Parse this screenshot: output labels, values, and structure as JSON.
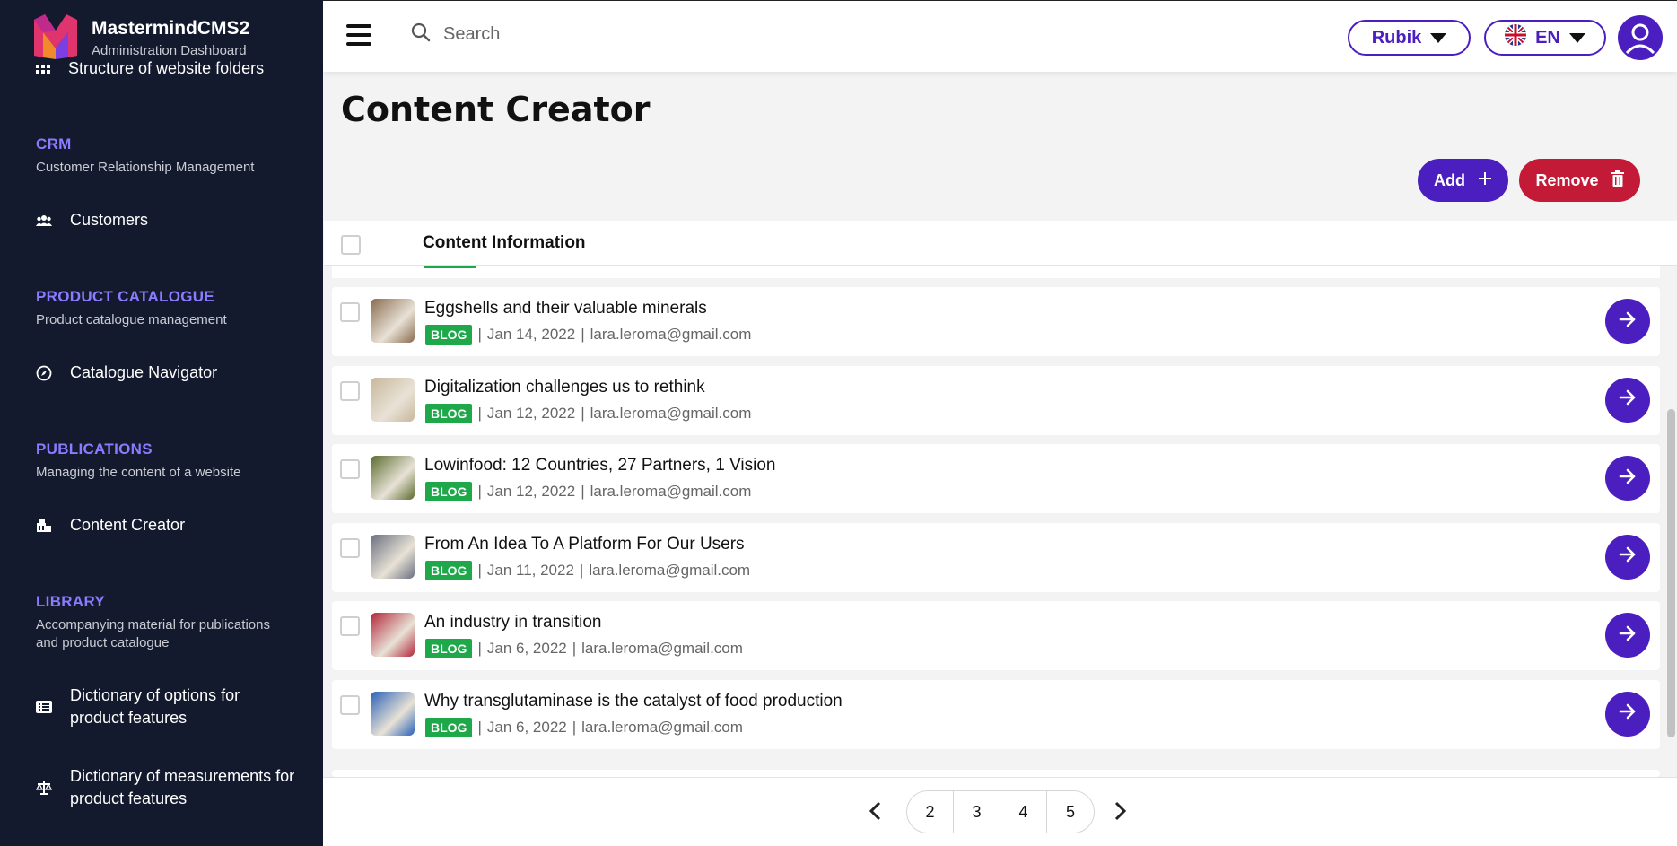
{
  "brand": {
    "name": "MastermindCMS2",
    "subtitle": "Administration Dashboard"
  },
  "sidebar": {
    "cut_item": "Structure of website folders",
    "sections": [
      {
        "title": "CRM",
        "desc": "Customer Relationship Management",
        "items": [
          {
            "label": "Customers",
            "icon": "users-icon"
          }
        ]
      },
      {
        "title": "PRODUCT CATALOGUE",
        "desc": "Product catalogue management",
        "items": [
          {
            "label": "Catalogue Navigator",
            "icon": "compass-icon"
          }
        ]
      },
      {
        "title": "PUBLICATIONS",
        "desc": "Managing the content of a website",
        "items": [
          {
            "label": "Content Creator",
            "icon": "content-icon"
          }
        ]
      },
      {
        "title": "LIBRARY",
        "desc": "Accompanying material for publications and product catalogue",
        "items": [
          {
            "label": "Dictionary of options for product features",
            "icon": "list-icon"
          },
          {
            "label": "Dictionary of measurements for product features",
            "icon": "scale-icon"
          }
        ]
      }
    ]
  },
  "topbar": {
    "search_placeholder": "Search",
    "workspace": "Rubik",
    "language": "EN"
  },
  "page": {
    "title": "Content Creator",
    "add_label": "Add",
    "remove_label": "Remove",
    "column_header": "Content Information"
  },
  "rows": [
    {
      "title": "Eggshells and their valuable minerals",
      "tag": "BLOG",
      "date": "Jan 14, 2022",
      "author": "lara.leroma@gmail.com",
      "thumb_color": "#8a6b4f"
    },
    {
      "title": "Digitalization challenges us to rethink",
      "tag": "BLOG",
      "date": "Jan 12, 2022",
      "author": "lara.leroma@gmail.com",
      "thumb_color": "#c8b79c"
    },
    {
      "title": "Lowinfood: 12 Countries, 27 Partners, 1 Vision",
      "tag": "BLOG",
      "date": "Jan 12, 2022",
      "author": "lara.leroma@gmail.com",
      "thumb_color": "#5b6b2f"
    },
    {
      "title": "From An Idea To A Platform For Our Users",
      "tag": "BLOG",
      "date": "Jan 11, 2022",
      "author": "lara.leroma@gmail.com",
      "thumb_color": "#6a7080"
    },
    {
      "title": "An industry in transition",
      "tag": "BLOG",
      "date": "Jan 6, 2022",
      "author": "lara.leroma@gmail.com",
      "thumb_color": "#b3263a"
    },
    {
      "title": "Why transglutaminase is the catalyst of food production",
      "tag": "BLOG",
      "date": "Jan 6, 2022",
      "author": "lara.leroma@gmail.com",
      "thumb_color": "#2a62b8"
    }
  ],
  "pagination": {
    "pages": [
      "2",
      "3",
      "4",
      "5"
    ]
  },
  "colors": {
    "accent": "#4b1fbf",
    "danger": "#c21a37",
    "tag": "#1ea84a",
    "sidebar": "#141a2e",
    "section_title": "#8a7bff"
  }
}
